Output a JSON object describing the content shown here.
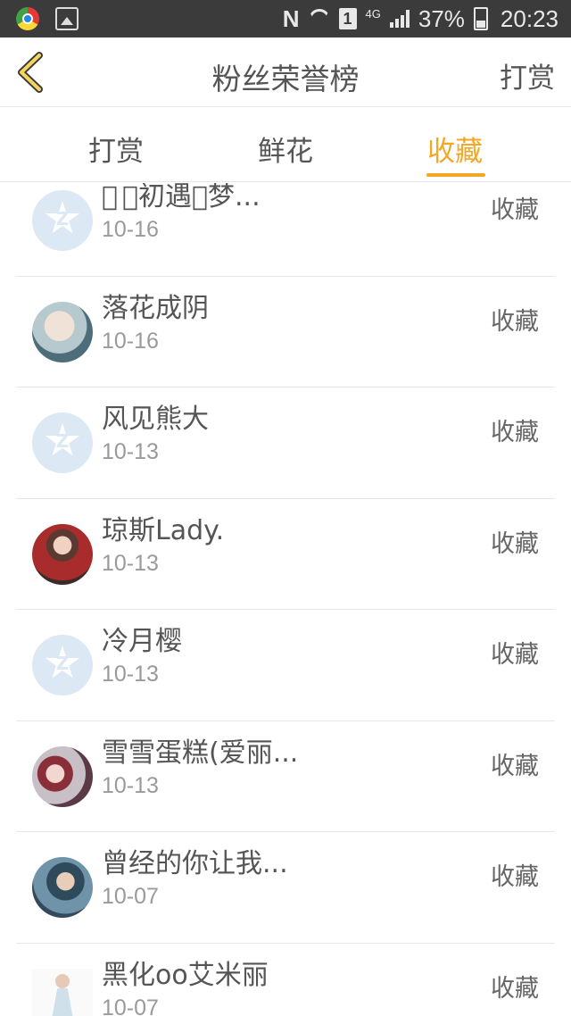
{
  "status_bar": {
    "n_label": "N",
    "sim": "1",
    "network": "4G",
    "battery": "37%",
    "time": "20:23",
    "icons": [
      "chrome-icon",
      "gallery-icon",
      "nfc-icon",
      "wifi-icon",
      "sim-icon",
      "signal-icon",
      "battery-icon"
    ]
  },
  "header": {
    "title": "粉丝荣誉榜",
    "right_action": "打赏",
    "back_icon": "chevron-left-icon",
    "accent_color": "#f5a623"
  },
  "tabs": [
    {
      "label": "打赏",
      "active": false
    },
    {
      "label": "鲜花",
      "active": false
    },
    {
      "label": "收藏",
      "active": true
    }
  ],
  "list": [
    {
      "name": "\u0000 \u0000初遇\u0000梦...",
      "date": "10-16",
      "action": "收藏",
      "avatar": "default"
    },
    {
      "name": "落花成阴",
      "date": "10-16",
      "action": "收藏",
      "avatar": "photo"
    },
    {
      "name": "风见熊大",
      "date": "10-13",
      "action": "收藏",
      "avatar": "default"
    },
    {
      "name": "琼斯Lady.",
      "date": "10-13",
      "action": "收藏",
      "avatar": "photo"
    },
    {
      "name": "冷月樱",
      "date": "10-13",
      "action": "收藏",
      "avatar": "default"
    },
    {
      "name": "雪雪蛋糕(爱丽...",
      "date": "10-13",
      "action": "收藏",
      "avatar": "photo"
    },
    {
      "name": "曾经的你让我...",
      "date": "10-07",
      "action": "收藏",
      "avatar": "photo"
    },
    {
      "name": "黑化oo艾米丽",
      "date": "10-07",
      "action": "收藏",
      "avatar": "photo"
    }
  ]
}
